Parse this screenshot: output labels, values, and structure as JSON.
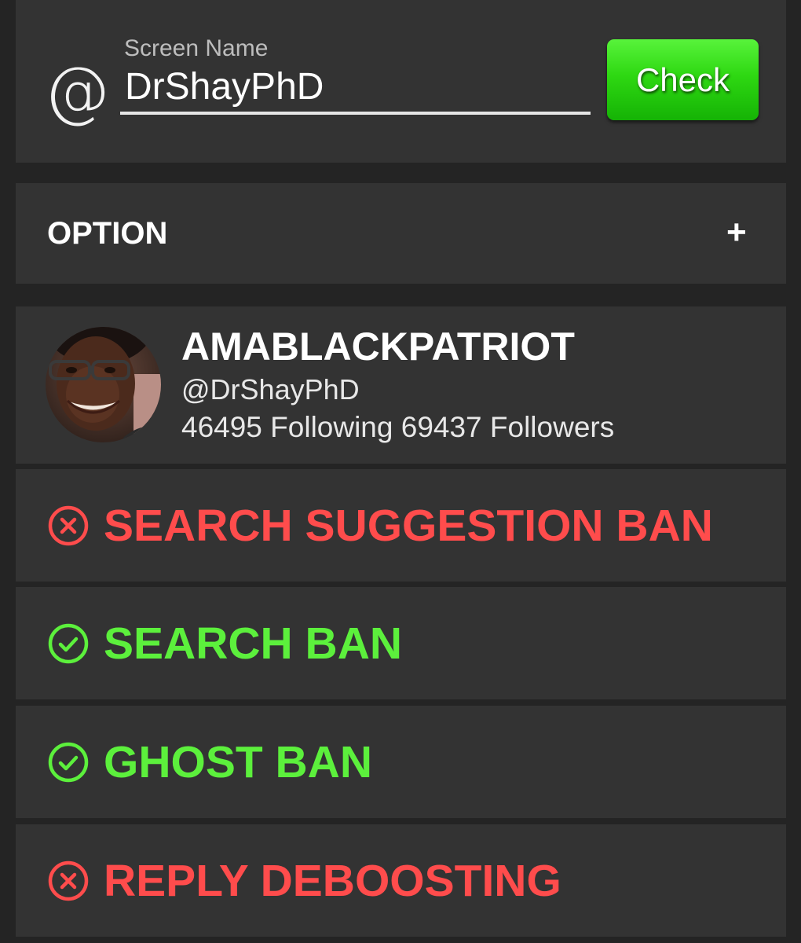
{
  "search": {
    "at_symbol": "@",
    "label": "Screen Name",
    "value": "DrShayPhD",
    "button_label": "Check"
  },
  "option": {
    "label": "OPTION",
    "expand_symbol": "+"
  },
  "profile": {
    "display_name": "AMABLACKPATRIOT",
    "handle": "@DrShayPhD",
    "stats": "46495 Following 69437 Followers"
  },
  "results": [
    {
      "label": "SEARCH SUGGESTION BAN",
      "status": "banned",
      "icon": "x-circle-icon",
      "color": "#ff4c4c"
    },
    {
      "label": "SEARCH BAN",
      "status": "ok",
      "icon": "check-circle-icon",
      "color": "#5cf03c"
    },
    {
      "label": "GHOST BAN",
      "status": "ok",
      "icon": "check-circle-icon",
      "color": "#5cf03c"
    },
    {
      "label": "REPLY DEBOOSTING",
      "status": "banned",
      "icon": "x-circle-icon",
      "color": "#ff4c4c"
    }
  ],
  "colors": {
    "background": "#242424",
    "card": "#333333",
    "button_green": "#2ed812",
    "banned_red": "#ff4c4c",
    "ok_green": "#5cf03c"
  }
}
